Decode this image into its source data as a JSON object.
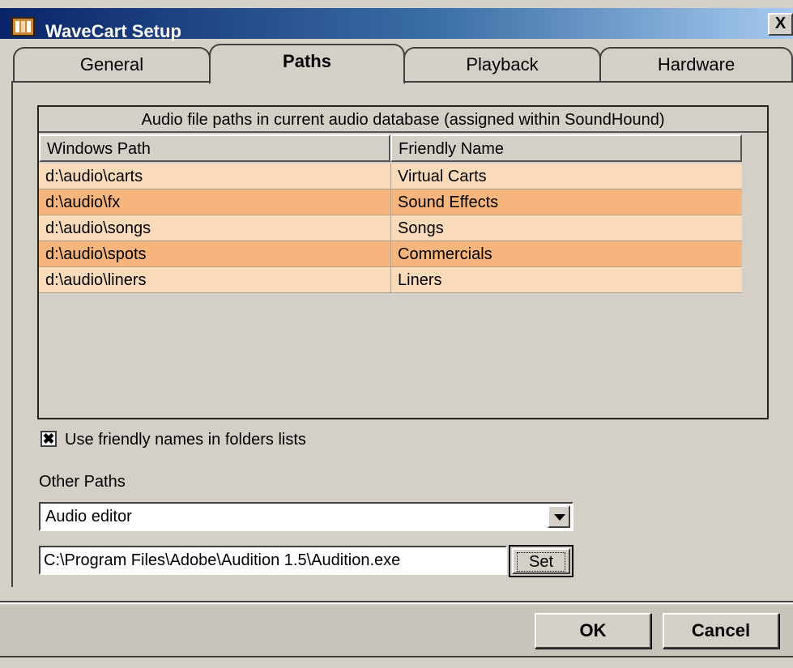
{
  "window": {
    "title": "WaveCart Setup",
    "close_label": "X"
  },
  "tabs": [
    {
      "label": "General",
      "active": false
    },
    {
      "label": "Paths",
      "active": true
    },
    {
      "label": "Playback",
      "active": false
    },
    {
      "label": "Hardware",
      "active": false
    }
  ],
  "paths_table": {
    "caption": "Audio file paths in current audio database (assigned within SoundHound)",
    "columns": [
      "Windows Path",
      "Friendly Name"
    ],
    "rows": [
      {
        "path": "d:\\audio\\carts",
        "name": "Virtual Carts"
      },
      {
        "path": "d:\\audio\\fx",
        "name": "Sound Effects"
      },
      {
        "path": "d:\\audio\\songs",
        "name": "Songs"
      },
      {
        "path": "d:\\audio\\spots",
        "name": "Commercials"
      },
      {
        "path": "d:\\audio\\liners",
        "name": "Liners"
      }
    ],
    "colors": {
      "row_light": "#fadbb9",
      "row_dark": "#f6b57c"
    }
  },
  "friendly_names_checkbox": {
    "label": "Use friendly names in folders lists",
    "checked": true,
    "mark": "✖"
  },
  "other_paths": {
    "label": "Other Paths",
    "selected": "Audio editor",
    "path_value": "C:\\Program Files\\Adobe\\Audition 1.5\\Audition.exe",
    "set_label": "Set"
  },
  "footer": {
    "ok_label": "OK",
    "cancel_label": "Cancel"
  },
  "icons": {
    "app": "app-icon",
    "dropdown": "chevron-down-icon"
  }
}
